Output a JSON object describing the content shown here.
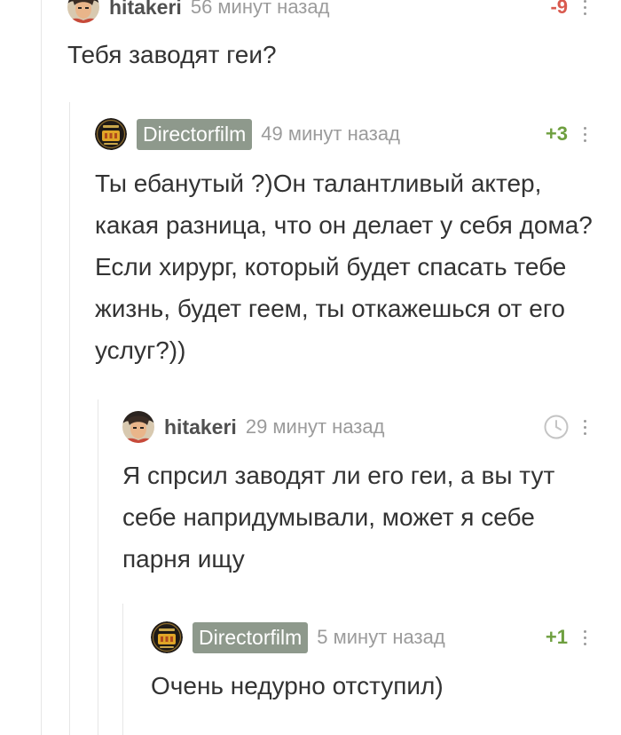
{
  "colors": {
    "positive_rating": "#6e9f3f",
    "negative_rating": "#d95a4f",
    "highlighted_username_bg": "#8e998c",
    "timestamp": "#9b9b9b",
    "text": "#333333"
  },
  "comments": [
    {
      "username": "hitakeri",
      "timestamp": "56 минут назад",
      "rating": "-9",
      "text": "Тебя заводят геи?",
      "avatar_icon": "anime-avatar"
    },
    {
      "username": "Directorfilm",
      "timestamp": "49 минут назад",
      "rating": "+3",
      "text": "Ты ебанутый ?)Он талантливый актер, какая разница, что он делает у себя дома? Если хирург, который будет спасать тебе жизнь, будет геем, ты откажешься от его услуг?))",
      "avatar_icon": "film-badge-avatar"
    },
    {
      "username": "hitakeri",
      "timestamp": "29 минут назад",
      "rating": "",
      "text": "Я спрсил заводят ли его геи, а вы тут себе напридумывали, может я себе парня ищу",
      "avatar_icon": "anime-avatar",
      "status_icon": "clock-icon"
    },
    {
      "username": "Directorfilm",
      "timestamp": "5 минут назад",
      "rating": "+1",
      "text": "Очень недурно отступил)",
      "avatar_icon": "film-badge-avatar"
    }
  ]
}
